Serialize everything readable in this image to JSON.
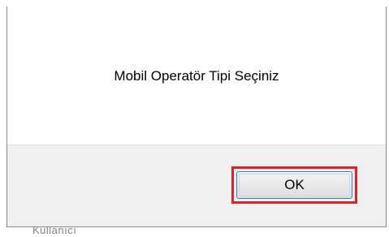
{
  "dialog": {
    "message": "Mobil Operatör Tipi Seçiniz",
    "ok_label": "OK"
  },
  "background": {
    "partial_text": "Kullanıcı"
  },
  "colors": {
    "highlight": "#e0202a",
    "footer_bg": "#f0f0f0",
    "button_border": "#3c7fb1"
  }
}
